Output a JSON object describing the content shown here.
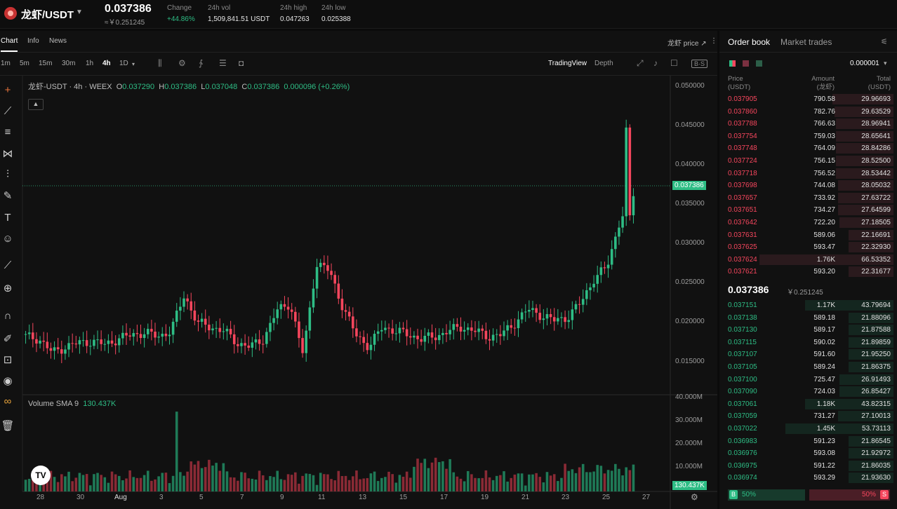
{
  "header": {
    "pair": "龙虾/USDT",
    "last_price": "0.037386",
    "last_fiat": "≈￥0.251245",
    "stats": [
      {
        "label": "Change",
        "value": "+44.86%"
      },
      {
        "label": "24h vol",
        "value": "1,509,841.51 USDT"
      },
      {
        "label": "24h high",
        "value": "0.047263"
      },
      {
        "label": "24h low",
        "value": "0.025388"
      }
    ]
  },
  "chart_tabs": [
    "Chart",
    "Info",
    "News"
  ],
  "price_source": "龙虾 price ↗",
  "timeframes": [
    "1m",
    "5m",
    "15m",
    "30m",
    "1h",
    "4h",
    "1D"
  ],
  "active_timeframe": "4h",
  "view_modes": {
    "tradingview": "TradingView",
    "depth": "Depth"
  },
  "legend": {
    "symbol": "龙虾-USDT · 4h · WEEX",
    "o_label": "O",
    "o": "0.037290",
    "h_label": "H",
    "h": "0.037386",
    "l_label": "L",
    "l": "0.037048",
    "c_label": "C",
    "c": "0.037386",
    "chg": "0.000096 (+0.26%)"
  },
  "volume_legend": {
    "label": "Volume SMA 9",
    "value": "130.437K"
  },
  "price_axis": [
    "0.050000",
    "0.045000",
    "0.040000",
    "0.035000",
    "0.030000",
    "0.025000",
    "0.020000",
    "0.015000"
  ],
  "last_price_tag": "0.037386",
  "volume_axis": [
    "40.000M",
    "30.000M",
    "20.000M",
    "10.000M"
  ],
  "volume_tag": "130.437K",
  "time_axis": [
    "28",
    "30",
    "Aug",
    "3",
    "5",
    "7",
    "9",
    "11",
    "13",
    "15",
    "17",
    "19",
    "21",
    "23",
    "25",
    "27"
  ],
  "orderbook": {
    "tabs": [
      "Order book",
      "Market trades"
    ],
    "precision": "0.000001",
    "headers": {
      "price": "Price",
      "price_unit": "(USDT)",
      "amount": "Amount",
      "amount_unit": "(龙虾)",
      "total": "Total",
      "total_unit": "(USDT)"
    },
    "asks": [
      {
        "price": "0.037905",
        "amount": "790.58",
        "total": "29.96693",
        "depth": 0.35
      },
      {
        "price": "0.037860",
        "amount": "782.76",
        "total": "29.63529",
        "depth": 0.34
      },
      {
        "price": "0.037788",
        "amount": "766.63",
        "total": "28.96941",
        "depth": 0.33
      },
      {
        "price": "0.037754",
        "amount": "759.03",
        "total": "28.65641",
        "depth": 0.33
      },
      {
        "price": "0.037748",
        "amount": "764.09",
        "total": "28.84286",
        "depth": 0.33
      },
      {
        "price": "0.037724",
        "amount": "756.15",
        "total": "28.52500",
        "depth": 0.33
      },
      {
        "price": "0.037718",
        "amount": "756.52",
        "total": "28.53442",
        "depth": 0.33
      },
      {
        "price": "0.037698",
        "amount": "744.08",
        "total": "28.05032",
        "depth": 0.32
      },
      {
        "price": "0.037657",
        "amount": "733.92",
        "total": "27.63722",
        "depth": 0.32
      },
      {
        "price": "0.037651",
        "amount": "734.27",
        "total": "27.64599",
        "depth": 0.32
      },
      {
        "price": "0.037642",
        "amount": "722.20",
        "total": "27.18505",
        "depth": 0.31
      },
      {
        "price": "0.037631",
        "amount": "589.06",
        "total": "22.16691",
        "depth": 0.26
      },
      {
        "price": "0.037625",
        "amount": "593.47",
        "total": "22.32930",
        "depth": 0.26
      },
      {
        "price": "0.037624",
        "amount": "1.76K",
        "total": "66.53352",
        "depth": 0.77
      },
      {
        "price": "0.037621",
        "amount": "593.20",
        "total": "22.31677",
        "depth": 0.26
      }
    ],
    "mid_price": "0.037386",
    "mid_fiat": "￥0.251245",
    "bids": [
      {
        "price": "0.037151",
        "amount": "1.17K",
        "total": "43.79694",
        "depth": 0.51
      },
      {
        "price": "0.037138",
        "amount": "589.18",
        "total": "21.88096",
        "depth": 0.26
      },
      {
        "price": "0.037130",
        "amount": "589.17",
        "total": "21.87588",
        "depth": 0.26
      },
      {
        "price": "0.037115",
        "amount": "590.02",
        "total": "21.89859",
        "depth": 0.26
      },
      {
        "price": "0.037107",
        "amount": "591.60",
        "total": "21.95250",
        "depth": 0.26
      },
      {
        "price": "0.037105",
        "amount": "589.24",
        "total": "21.86375",
        "depth": 0.26
      },
      {
        "price": "0.037100",
        "amount": "725.47",
        "total": "26.91493",
        "depth": 0.31
      },
      {
        "price": "0.037090",
        "amount": "724.03",
        "total": "26.85427",
        "depth": 0.31
      },
      {
        "price": "0.037061",
        "amount": "1.18K",
        "total": "43.82315",
        "depth": 0.51
      },
      {
        "price": "0.037059",
        "amount": "731.27",
        "total": "27.10013",
        "depth": 0.32
      },
      {
        "price": "0.037022",
        "amount": "1.45K",
        "total": "53.73113",
        "depth": 0.62
      },
      {
        "price": "0.036983",
        "amount": "591.23",
        "total": "21.86545",
        "depth": 0.26
      },
      {
        "price": "0.036976",
        "amount": "593.08",
        "total": "21.92972",
        "depth": 0.26
      },
      {
        "price": "0.036975",
        "amount": "591.22",
        "total": "21.86035",
        "depth": 0.26
      },
      {
        "price": "0.036974",
        "amount": "593.29",
        "total": "21.93630",
        "depth": 0.26
      }
    ],
    "buy_ratio": {
      "badge": "B",
      "value": "50%"
    },
    "sell_ratio": {
      "badge": "S",
      "value": "50%"
    }
  },
  "colors": {
    "up": "#2ebd85",
    "down": "#f6465d",
    "background": "#111111"
  },
  "chart_data": {
    "type": "candlestick",
    "interval": "4h",
    "price_range": [
      0.0125,
      0.0525
    ],
    "approx_closes": [
      0.0198,
      0.0195,
      0.0178,
      0.0185,
      0.019,
      0.0192,
      0.0188,
      0.0195,
      0.02,
      0.0203,
      0.0198,
      0.0205,
      0.025,
      0.0215,
      0.021,
      0.0205,
      0.019,
      0.0185,
      0.0195,
      0.023,
      0.024,
      0.0175,
      0.029,
      0.028,
      0.0235,
      0.02,
      0.0185,
      0.021,
      0.0205,
      0.02,
      0.0195,
      0.0198,
      0.0205,
      0.021,
      0.0205,
      0.0198,
      0.02,
      0.0215,
      0.0232,
      0.0225,
      0.0218,
      0.0222,
      0.024,
      0.027,
      0.0285,
      0.0345,
      0.0374
    ]
  }
}
